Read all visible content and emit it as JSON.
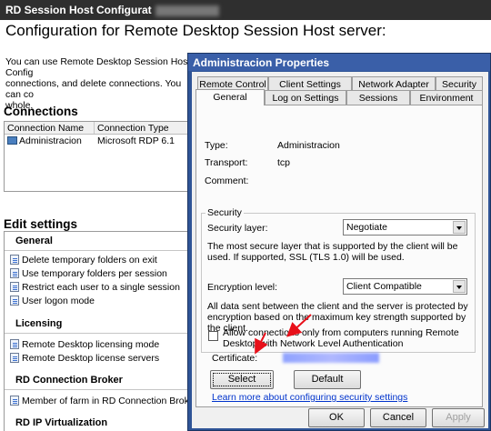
{
  "background_window": {
    "title": "RD Session Host Configurat",
    "heading": "Configuration for Remote Desktop Session Host server:",
    "intro_lines": [
      "You can use Remote Desktop Session Host Config",
      "connections, and delete connections. You can co",
      "whole."
    ],
    "connections_title": "Connections",
    "connections_columns": [
      "Connection Name",
      "Connection Type"
    ],
    "connections_rows": [
      {
        "name": "Administracion",
        "type": "Microsoft RDP 6.1"
      }
    ],
    "edit_settings_title": "Edit settings",
    "groups": {
      "general": {
        "title": "General",
        "items": [
          "Delete temporary folders on exit",
          "Use temporary folders per session",
          "Restrict each user to a single session",
          "User logon mode"
        ]
      },
      "licensing": {
        "title": "Licensing",
        "items": [
          "Remote Desktop licensing mode",
          "Remote Desktop license servers"
        ]
      },
      "broker": {
        "title": "RD Connection Broker",
        "items": [
          "Member of farm in RD Connection Broker"
        ]
      },
      "virtualization": {
        "title": "RD IP Virtualization"
      }
    }
  },
  "dialog": {
    "title": "Administracion Properties",
    "tabs_row1": [
      "Remote Control",
      "Client Settings",
      "Network Adapter",
      "Security"
    ],
    "tabs_row2": [
      "General",
      "Log on Settings",
      "Sessions",
      "Environment"
    ],
    "active_tab": "General",
    "type_label": "Type:",
    "type_value": "Administracion",
    "transport_label": "Transport:",
    "transport_value": "tcp",
    "comment_label": "Comment:",
    "comment_value": "",
    "security_group": "Security",
    "security_layer_label": "Security layer:",
    "security_layer_value": "Negotiate",
    "security_layer_desc": "The most secure layer that is supported by the client will be used. If supported, SSL (TLS 1.0) will be used.",
    "encryption_label": "Encryption level:",
    "encryption_value": "Client Compatible",
    "encryption_desc": "All data sent between the client and the server is protected by encryption based on the maximum key strength supported by the client.",
    "nla_label": "Allow connections only from computers running Remote Desktop with Network Level Authentication",
    "nla_checked": false,
    "certificate_label": "Certificate:",
    "select_button": "Select",
    "default_button": "Default",
    "learn_link": "Learn more about configuring security settings",
    "ok_button": "OK",
    "cancel_button": "Cancel",
    "apply_button": "Apply"
  },
  "colors": {
    "dialog_frame": "#2f5496",
    "annotation_arrow": "#e8101a",
    "link": "#0033cc"
  }
}
